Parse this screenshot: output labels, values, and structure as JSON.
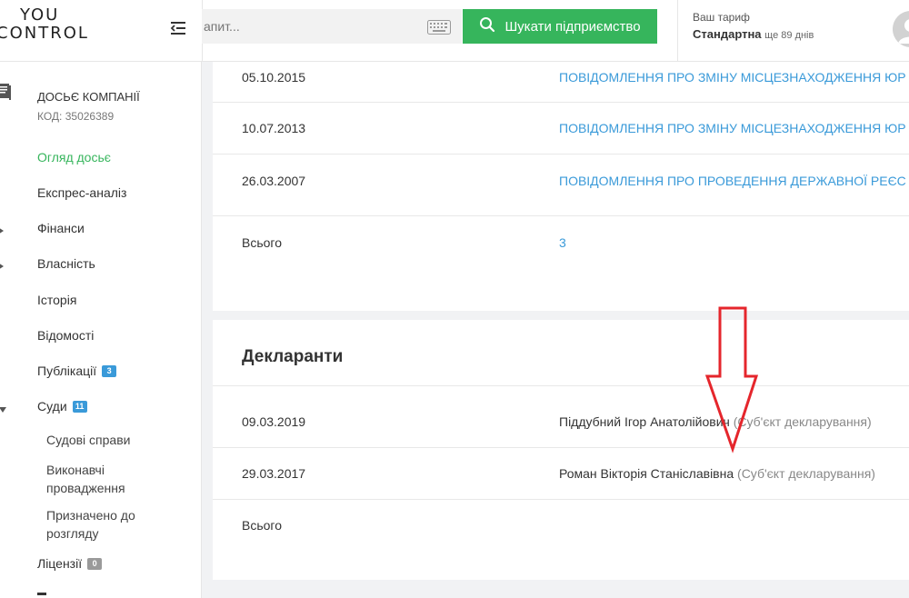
{
  "header": {
    "logo_top": "YOU",
    "logo_bottom": "CONTROL",
    "search_placeholder": "апит...",
    "search_button_label": "Шукати підприємство",
    "tariff_label": "Ваш тариф",
    "tariff_name": "Стандартна",
    "tariff_days": "ще 89 днів"
  },
  "sidebar": {
    "dossier_title": "ДОСЬЄ КОМПАНІЇ",
    "dossier_code": "КОД: 35026389",
    "items": [
      {
        "label": "Огляд досьє"
      },
      {
        "label": "Експрес-аналіз"
      },
      {
        "label": "Фінанси"
      },
      {
        "label": "Власність"
      },
      {
        "label": "Історія"
      },
      {
        "label": "Відомості"
      },
      {
        "label": "Публікації",
        "badge": "3"
      },
      {
        "label": "Суди",
        "badge": "11"
      },
      {
        "label": "Ліцензії",
        "badge": "0"
      }
    ],
    "sub_items": [
      {
        "label": "Судові справи"
      },
      {
        "label": "Виконавчі провадження"
      },
      {
        "label": "Призначено до розгляду"
      }
    ]
  },
  "publications": {
    "rows": [
      {
        "date": "05.10.2015",
        "text": "ПОВІДОМЛЕННЯ ПРО ЗМІНУ МІСЦЕЗНАХОДЖЕННЯ ЮР"
      },
      {
        "date": "10.07.2013",
        "text": "ПОВІДОМЛЕННЯ ПРО ЗМІНУ МІСЦЕЗНАХОДЖЕННЯ ЮР"
      },
      {
        "date": "26.03.2007",
        "text": "ПОВІДОМЛЕННЯ ПРО ПРОВЕДЕННЯ ДЕРЖАВНОЇ РЕЄС"
      }
    ],
    "total_label": "Всього",
    "total_value": "3"
  },
  "declarants": {
    "title": "Декларанти",
    "rows": [
      {
        "date": "09.03.2019",
        "name": "Піддубний Ігор Анатолійович",
        "role": "(Суб'єкт декларування)"
      },
      {
        "date": "29.03.2017",
        "name": "Роман Вікторія Станіславівна",
        "role": "(Суб'єкт декларування)"
      }
    ],
    "total_label": "Всього"
  },
  "colors": {
    "accent_green": "#36b55c",
    "link_blue": "#3a9ad9",
    "annotation_red": "#e5262c"
  }
}
